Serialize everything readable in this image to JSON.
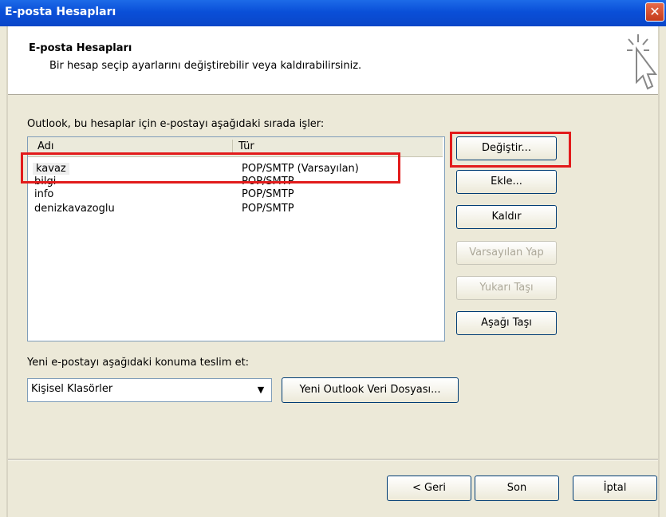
{
  "window": {
    "title": "E-posta Hesapları",
    "close_label": "✕"
  },
  "header": {
    "title": "E-posta Hesapları",
    "subtitle": "Bir hesap seçip ayarlarını değiştirebilir veya kaldırabilirsiniz."
  },
  "accounts": {
    "caption": "Outlook, bu hesaplar için e-postayı aşağıdaki sırada işler:",
    "columns": [
      "Adı",
      "Tür"
    ],
    "rows": [
      {
        "name": "kavaz",
        "type": "POP/SMTP (Varsayılan)"
      },
      {
        "name": "bilgi",
        "type": "POP/SMTP"
      },
      {
        "name": "info",
        "type": "POP/SMTP"
      },
      {
        "name": "denizkavazoglu",
        "type": "POP/SMTP"
      }
    ]
  },
  "buttons": {
    "change": "Değiştir...",
    "add": "Ekle...",
    "remove": "Kaldır",
    "set_default": "Varsayılan Yap",
    "move_up": "Yukarı Taşı",
    "move_down": "Aşağı Taşı"
  },
  "delivery": {
    "label": "Yeni e-postayı aşağıdaki konuma teslim et:",
    "selected": "Kişisel Klasörler",
    "new_file_button": "Yeni Outlook Veri Dosyası..."
  },
  "footer": {
    "back": "< Geri",
    "finish": "Son",
    "cancel": "İptal"
  },
  "colors": {
    "highlight_box": "#e21b1b",
    "titlebar": "#0a4fd8"
  },
  "icons": {
    "header": "cursor-click-icon",
    "combo_arrow": "chevron-down-icon"
  }
}
